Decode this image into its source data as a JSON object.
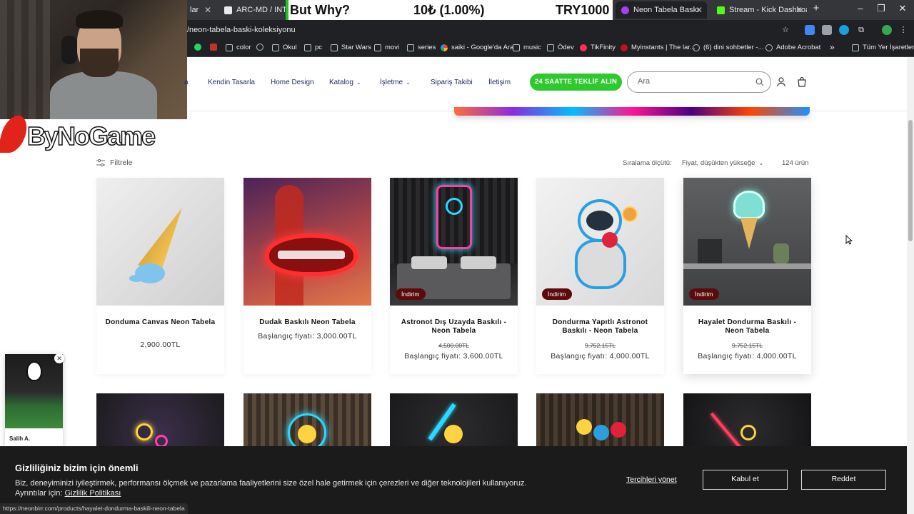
{
  "browser": {
    "tabs": [
      {
        "label": "lar",
        "color": "#8ab4f8"
      },
      {
        "label": "ARC-MD / INTEL Cor",
        "color": "#e8eaed"
      },
      {
        "label": "Neon Tabela Baskı Koleksi",
        "color": "#a142f4",
        "active": true
      },
      {
        "label": "Stream - Kick Dashboard",
        "color": "#53fc18"
      }
    ],
    "new_tab": "+",
    "ticker": {
      "left": "But Why?",
      "middle": "10₺ (1.00%)",
      "right": "TRY1000"
    },
    "url": "/neon-tabela-baski-koleksiyonu",
    "bookmarks": [
      {
        "label": "color",
        "icon": "link-icon"
      },
      {
        "label": "Okul",
        "icon": "folder-icon"
      },
      {
        "label": "pc",
        "icon": "folder-icon"
      },
      {
        "label": "Star Wars",
        "icon": "folder-icon"
      },
      {
        "label": "movi",
        "icon": "folder-icon"
      },
      {
        "label": "series",
        "icon": "folder-icon"
      },
      {
        "label": "saiki - Google'da Ara",
        "icon": "google-icon"
      },
      {
        "label": "music",
        "icon": "folder-icon"
      },
      {
        "label": "Ödev",
        "icon": "folder-icon"
      },
      {
        "label": "TikFinity",
        "icon": "tikfinity-icon"
      },
      {
        "label": "Myinstants | The lar...",
        "icon": "myinstants-icon"
      },
      {
        "label": "(6) dini sohbetler -...",
        "icon": "globe-icon"
      },
      {
        "label": "Adobe Acrobat",
        "icon": "globe-icon"
      },
      {
        "label": "»",
        "icon": ""
      },
      {
        "label": "Tüm Yer İşaretleri",
        "icon": "folder-icon"
      }
    ]
  },
  "overlay": {
    "logo_text": "ByNoGame"
  },
  "store": {
    "nav": [
      {
        "label": "a",
        "dropdown": false
      },
      {
        "label": "Kendin Tasarla",
        "dropdown": false
      },
      {
        "label": "Home Design",
        "dropdown": false
      },
      {
        "label": "Katalog",
        "dropdown": true
      },
      {
        "label": "İşletme",
        "dropdown": true
      },
      {
        "label": "Sipariş Takibi",
        "dropdown": false
      },
      {
        "label": "İletişim",
        "dropdown": false
      }
    ],
    "cta": "24 SAATTE TEKLİF ALIN",
    "search_placeholder": "Ara"
  },
  "listing": {
    "filter_label": "Filtrele",
    "sort_label": "Sıralama ölçütü:",
    "sort_value": "Fiyat, düşükten yükseğe",
    "count": "124 ürün",
    "badge": "İndirim",
    "products": [
      {
        "title": "Donduma Canvas Neon Tabela",
        "old_price": "",
        "price": "2,900.00TL",
        "sale": false
      },
      {
        "title": "Dudak Baskılı Neon Tabela",
        "old_price": "",
        "price": "Başlangıç fiyatı: 3,000.00TL",
        "sale": false
      },
      {
        "title": "Astronot Dış Uzayda Baskılı - Neon Tabela",
        "old_price": "4,500.00TL",
        "price": "Başlangıç fiyatı: 3,600.00TL",
        "sale": true
      },
      {
        "title": "Dondurma Yapıtlı Astronot Baskılı - Neon Tabela",
        "old_price": "9,752.15TL",
        "price": "Başlangıç fiyatı: 4,000.00TL",
        "sale": true
      },
      {
        "title": "Hayalet Dondurma Baskılı - Neon Tabela",
        "old_price": "9,752.15TL",
        "price": "Başlangıç fiyatı: 4,000.00TL",
        "sale": true
      }
    ]
  },
  "notification": {
    "name": "Salih A."
  },
  "cookie": {
    "title": "Gizliliğiniz bizim için önemli",
    "text": "Biz, deneyiminizi iyileştirmek, performansı ölçmek ve pazarlama faaliyetlerini size özel hale getirmek için çerezleri ve diğer teknolojileri kullanıyoruz.",
    "details_prefix": "Ayrıntılar için:",
    "details_link": "Gizlilik Politikası",
    "manage": "Tercihleri yönet",
    "accept": "Kabul et",
    "reject": "Reddet"
  },
  "status_url": "https://neonbirr.com/products/hayalet-dondurma-baskili-neon-tabela"
}
